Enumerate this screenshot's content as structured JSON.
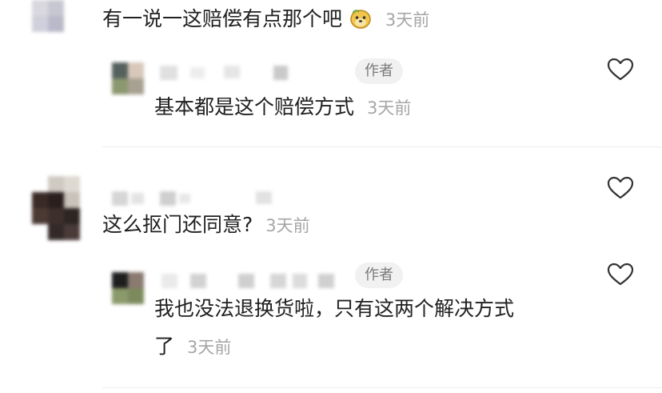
{
  "comments": [
    {
      "text": "有一说一这赔偿有点那个吧",
      "time": "3天前",
      "emoji_icon": "dog-face-emoji-icon",
      "reply": {
        "badge": "作者",
        "text": "基本都是这个赔偿方式",
        "time": "3天前"
      }
    },
    {
      "text": "这么抠门还同意?",
      "time": "3天前",
      "reply": {
        "badge": "作者",
        "text_line1": "我也没法退换货啦，只有这两个解决方式",
        "text_line2": "了",
        "time": "3天前"
      }
    }
  ],
  "colors": {
    "badge_bg": "#f1f1f1",
    "time_gray": "#a6a6a6",
    "divider": "#ececec"
  }
}
